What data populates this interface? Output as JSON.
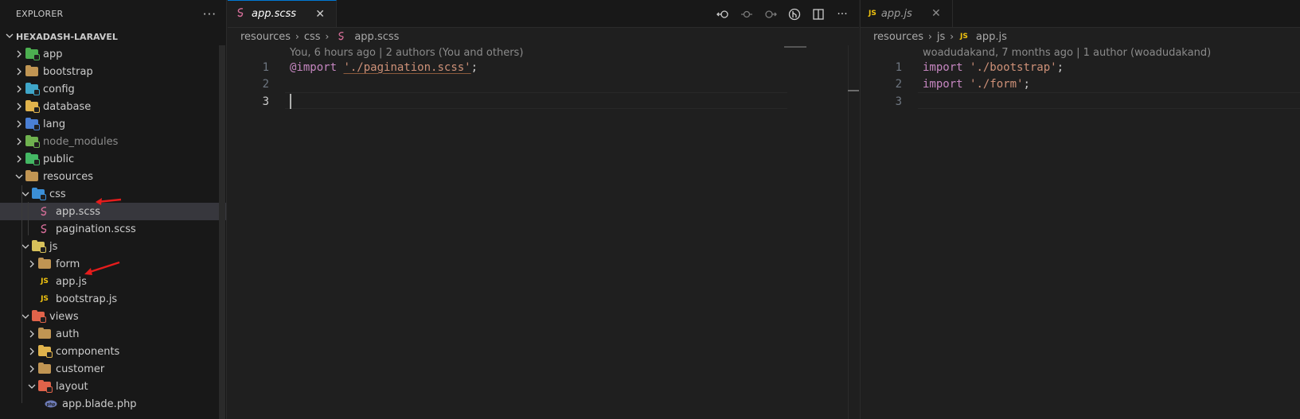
{
  "sidebar": {
    "title": "EXPLORER",
    "more_label": "···",
    "root": "HEXADASH-LARAVEL",
    "items": [
      {
        "label": "app",
        "icon": "folder-app-icon",
        "depth": 1,
        "expanded": false,
        "color": "#4caf50"
      },
      {
        "label": "bootstrap",
        "icon": "folder-icon",
        "depth": 1,
        "expanded": false,
        "color": "#c09553"
      },
      {
        "label": "config",
        "icon": "folder-config-icon",
        "depth": 1,
        "expanded": false,
        "color": "#3fa6c9"
      },
      {
        "label": "database",
        "icon": "folder-database-icon",
        "depth": 1,
        "expanded": false,
        "color": "#e0b34c"
      },
      {
        "label": "lang",
        "icon": "folder-lang-icon",
        "depth": 1,
        "expanded": false,
        "color": "#4a7fd4"
      },
      {
        "label": "node_modules",
        "icon": "folder-node-icon",
        "depth": 1,
        "expanded": false,
        "color": "#6fb24f",
        "dim": true
      },
      {
        "label": "public",
        "icon": "folder-public-icon",
        "depth": 1,
        "expanded": false,
        "color": "#44b864"
      },
      {
        "label": "resources",
        "icon": "folder-open-icon",
        "depth": 1,
        "expanded": true,
        "color": "#c09553"
      },
      {
        "label": "css",
        "icon": "folder-css-icon",
        "depth": 2,
        "expanded": true,
        "color": "#3b8fd6"
      },
      {
        "label": "app.scss",
        "icon": "scss-file-icon",
        "depth": 3,
        "file": true,
        "selected": true
      },
      {
        "label": "pagination.scss",
        "icon": "scss-file-icon",
        "depth": 3,
        "file": true
      },
      {
        "label": "js",
        "icon": "folder-js-icon",
        "depth": 2,
        "expanded": true,
        "color": "#d7c15a"
      },
      {
        "label": "form",
        "icon": "folder-icon",
        "depth": 3,
        "expanded": false,
        "color": "#c09553"
      },
      {
        "label": "app.js",
        "icon": "js-file-icon",
        "depth": 3,
        "file": true
      },
      {
        "label": "bootstrap.js",
        "icon": "js-file-icon",
        "depth": 3,
        "file": true
      },
      {
        "label": "views",
        "icon": "folder-views-icon",
        "depth": 2,
        "expanded": true,
        "color": "#e0634a"
      },
      {
        "label": "auth",
        "icon": "folder-icon",
        "depth": 3,
        "expanded": false,
        "color": "#c09553"
      },
      {
        "label": "components",
        "icon": "folder-components-icon",
        "depth": 3,
        "expanded": false,
        "color": "#e0b34c"
      },
      {
        "label": "customer",
        "icon": "folder-icon",
        "depth": 3,
        "expanded": false,
        "color": "#c09553"
      },
      {
        "label": "layout",
        "icon": "folder-layout-icon",
        "depth": 3,
        "expanded": true,
        "color": "#e0634a"
      },
      {
        "label": "app.blade.php",
        "icon": "php-file-icon",
        "depth": 4,
        "file": true
      }
    ]
  },
  "left_editor": {
    "tab": {
      "label": "app.scss",
      "icon": "scss-file-icon"
    },
    "breadcrumb": [
      "resources",
      "css",
      "app.scss"
    ],
    "blame": "You, 6 hours ago | 2 authors (You and others)",
    "lines": [
      {
        "n": "1",
        "at": "@import",
        "str": "'./pagination.scss'",
        "end": ";"
      },
      {
        "n": "2"
      },
      {
        "n": "3"
      }
    ],
    "actions": [
      "go-back-icon",
      "timeline-icon",
      "go-forward-icon",
      "git-compare-icon",
      "split-editor-icon",
      "more-actions-icon"
    ]
  },
  "right_editor": {
    "tab": {
      "label": "app.js",
      "icon": "js-file-icon",
      "icon_text": "JS"
    },
    "breadcrumb": [
      "resources",
      "js",
      "app.js"
    ],
    "breadcrumb_icon_text": "JS",
    "blame": "woadudakand, 7 months ago | 1 author (woadudakand)",
    "lines": [
      {
        "n": "1",
        "kw": "import",
        "str": "'./bootstrap'",
        "end": ";"
      },
      {
        "n": "2",
        "kw": "import",
        "str": "'./form'",
        "end": ";"
      },
      {
        "n": "3"
      }
    ]
  },
  "colors": {
    "accent": "#0078d4",
    "annotation_arrow": "#e51c1c",
    "keyword": "#c586c0",
    "string": "#ce9178"
  }
}
